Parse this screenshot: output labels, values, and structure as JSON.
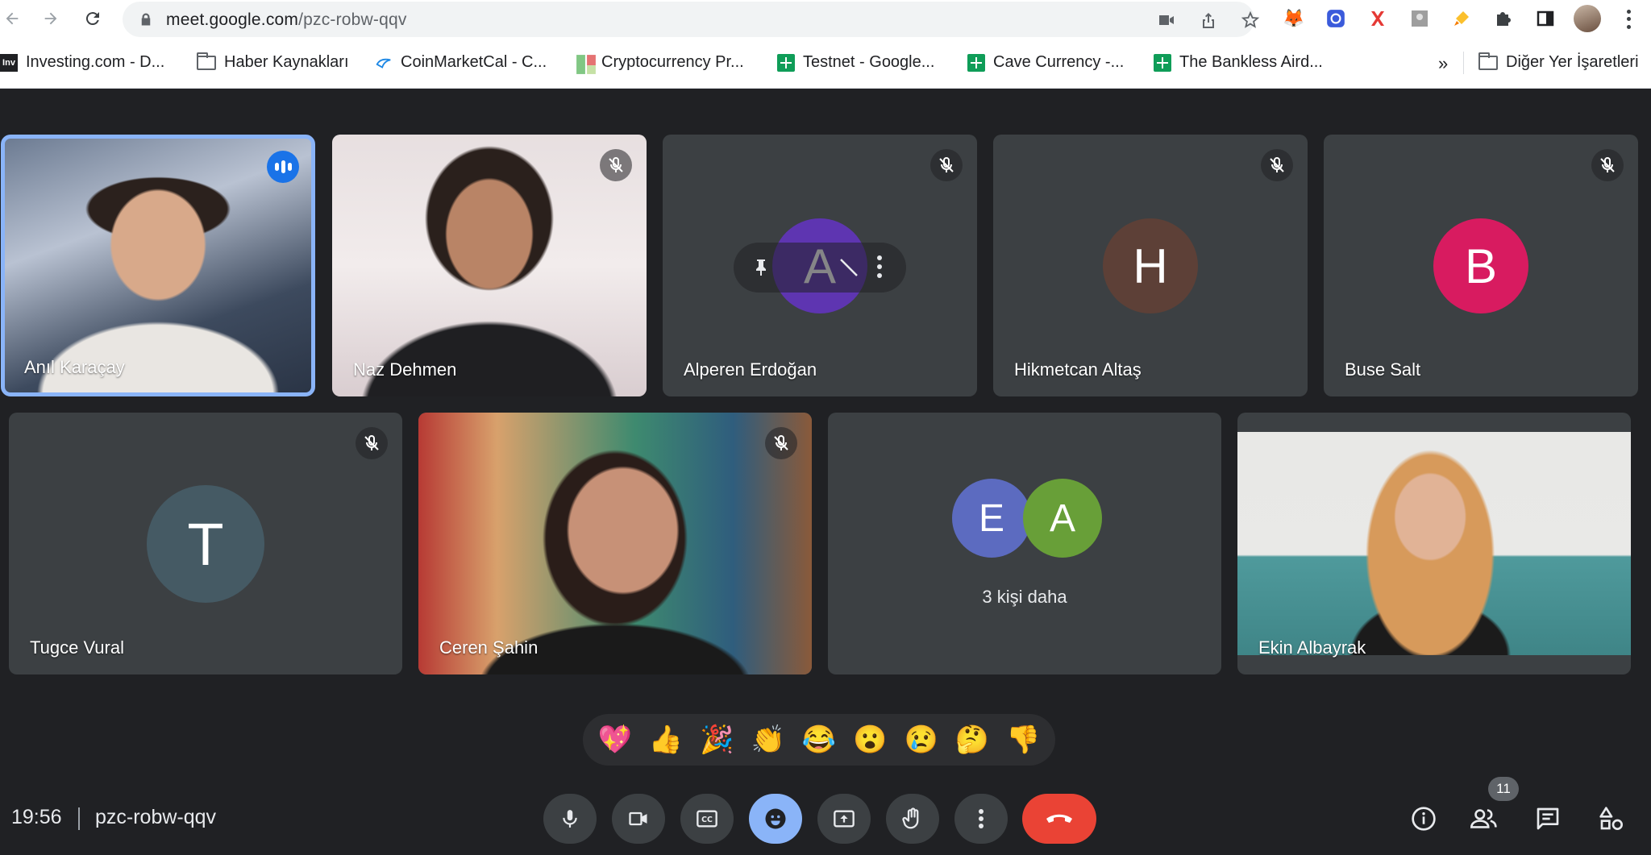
{
  "browser": {
    "url_host": "meet.google.com",
    "url_path": "/pzc-robw-qqv",
    "bookmarks": [
      {
        "label": "Investing.com - D...",
        "icon": "investing-icon"
      },
      {
        "label": "Haber Kaynakları",
        "icon": "folder-icon"
      },
      {
        "label": "CoinMarketCal - C...",
        "icon": "coinmarketcal-icon"
      },
      {
        "label": "Cryptocurrency Pr...",
        "icon": "chart-icon"
      },
      {
        "label": "Testnet - Google...",
        "icon": "sheets-icon"
      },
      {
        "label": "Cave Currency -...",
        "icon": "sheets-icon"
      },
      {
        "label": "The Bankless Aird...",
        "icon": "sheets-icon"
      }
    ],
    "bookmarks_overflow": "»",
    "other_bookmarks": "Diğer Yer İşaretleri"
  },
  "participants": [
    {
      "name": "Anıl Karaçay",
      "status": "speaking"
    },
    {
      "name": "Naz Dehmen",
      "status": "muted"
    },
    {
      "name": "Alperen Erdoğan",
      "initial": "A",
      "avatar_color": "#5e35b1",
      "status": "muted"
    },
    {
      "name": "Hikmetcan Altaş",
      "initial": "H",
      "avatar_color": "#5d4037",
      "status": "muted"
    },
    {
      "name": "Buse Salt",
      "initial": "B",
      "avatar_color": "#d81b60",
      "status": "muted"
    },
    {
      "name": "Tugce Vural",
      "initial": "T",
      "avatar_color": "#455a64",
      "status": "muted"
    },
    {
      "name": "Ceren Şahin",
      "status": "muted"
    },
    {
      "name": "Ekin Albayrak",
      "status": "video"
    }
  ],
  "overflow": {
    "initials": [
      "E",
      "A"
    ],
    "colors": [
      "#5c6bc0",
      "#689f38"
    ],
    "label": "3 kişi daha"
  },
  "reactions": [
    "💖",
    "👍",
    "🎉",
    "👏",
    "😂",
    "😮",
    "😢",
    "🤔",
    "👎"
  ],
  "meeting": {
    "time": "19:56",
    "code": "pzc-robw-qqv",
    "participant_count": "11"
  },
  "colors": {
    "background": "#202124",
    "tile": "#3c4043",
    "active_speaker_border": "#8ab4f8",
    "leave_button": "#ea4335"
  }
}
